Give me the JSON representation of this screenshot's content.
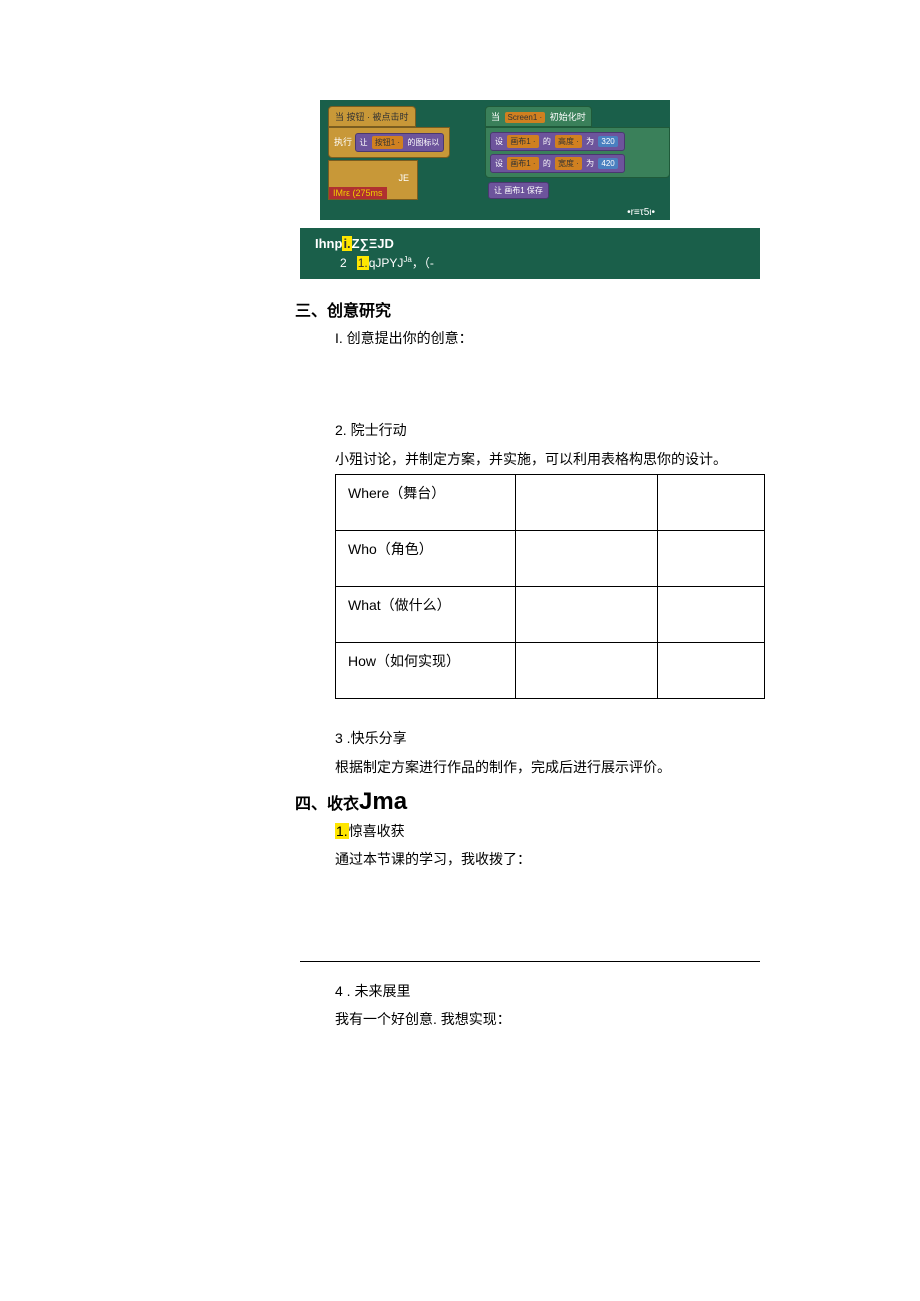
{
  "blocks": {
    "hat1": "当 按钮 · 被点击时",
    "body1_prefix": "执行",
    "body1_purple": "让",
    "body1_slot": "按钮1 ·",
    "body1_purple_tail": "的图标以",
    "hat2_prefix": "当",
    "hat2_slot": "Screen1 ·",
    "hat2_suffix": "初始化时",
    "g2_row1_a": "设",
    "g2_row1_slot1": "画布1 ·",
    "g2_row1_b": "的",
    "g2_row1_slot2": "高度 ·",
    "g2_row1_c": "为",
    "g2_row1_val": "320",
    "g2_row2_a": "设",
    "g2_row2_slot1": "画布1 ·",
    "g2_row2_b": "的",
    "g2_row2_slot2": "宽度 ·",
    "g2_row2_c": "为",
    "g2_row2_val": "420",
    "lone_purple": "让 画布1 保存",
    "je": "JE",
    "red_bottom": "IMrε  (275ms",
    "footer": "•r≡τ5ι•"
  },
  "greenbar": {
    "line1_a": "Ihnp",
    "line1_hl": "i.",
    "line1_b": "Z∑ΞJD",
    "line2_num": "2",
    "line2_hl": "1.",
    "line2_a": "qJPYJ",
    "line2_sup": "Ja",
    "line2_tail": "，（-"
  },
  "section3": {
    "title": "三、创意研究",
    "item1": "I. 创意提出你的创意：",
    "item2": "2. 院士行动",
    "item2_desc": "小殂讨论，并制定方案，并实施，可以利用表格构思你的设计。",
    "item3": "3   .快乐分享",
    "item3_desc": "根据制定方案进行作品的制作，完成后进行展示评价。"
  },
  "table": {
    "rows": [
      {
        "label": "Where（舞台）"
      },
      {
        "label": "Who（角色）"
      },
      {
        "label": "What（做什么）"
      },
      {
        "label": "How（如何实现）"
      }
    ]
  },
  "section4": {
    "title_a": "四、收衣",
    "title_b": "Jma",
    "item1_num": "1.",
    "item1_label": "惊喜收获",
    "item1_desc": "通过本节课的学习，我收拨了：",
    "item2": "4   . 未来展里",
    "item2_desc": "我有一个好创意. 我想实现："
  }
}
